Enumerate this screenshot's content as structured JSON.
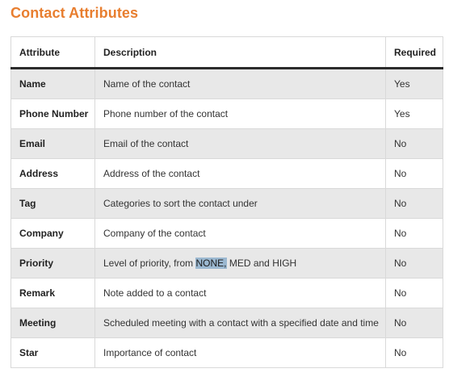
{
  "title": "Contact Attributes",
  "table": {
    "headers": [
      "Attribute",
      "Description",
      "Required"
    ],
    "rows": [
      {
        "attribute": "Name",
        "description": "Name of the contact",
        "required": "Yes"
      },
      {
        "attribute": "Phone Number",
        "description": "Phone number of the contact",
        "required": "Yes"
      },
      {
        "attribute": "Email",
        "description": "Email of the contact",
        "required": "No"
      },
      {
        "attribute": "Address",
        "description": "Address of the contact",
        "required": "No"
      },
      {
        "attribute": "Tag",
        "description": "Categories to sort the contact under",
        "required": "No"
      },
      {
        "attribute": "Company",
        "description": "Company of the contact",
        "required": "No"
      },
      {
        "attribute": "Priority",
        "description": "Level of priority, from NONE, MED and HIGH",
        "description_before": "Level of priority, from ",
        "description_selected": "NONE,",
        "description_after": " MED and HIGH",
        "required": "No"
      },
      {
        "attribute": "Remark",
        "description": "Note added to a contact",
        "required": "No"
      },
      {
        "attribute": "Meeting",
        "description": "Scheduled meeting with a contact with a specified date and time",
        "required": "No"
      },
      {
        "attribute": "Star",
        "description": "Importance of contact",
        "required": "No"
      }
    ]
  },
  "colors": {
    "title": "#e87e2f",
    "row_shade": "#e8e8e8",
    "selection_highlight": "#9bb8d0"
  }
}
